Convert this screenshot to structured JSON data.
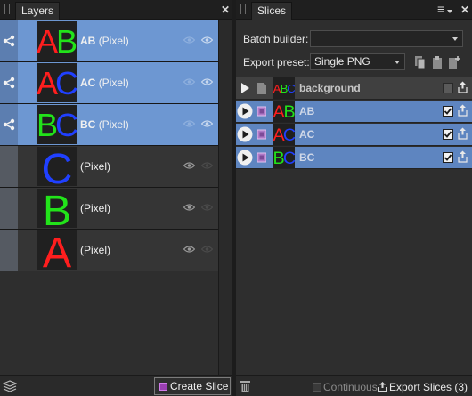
{
  "layers_panel": {
    "tab_label": "Layers",
    "close_glyph": "✕",
    "layers": [
      {
        "name": "AB",
        "type": "(Pixel)",
        "selected": true,
        "has_fx": true,
        "letters": [
          [
            "A",
            "#ff1e1e"
          ],
          [
            "B",
            "#22e31a"
          ]
        ]
      },
      {
        "name": "AC",
        "type": "(Pixel)",
        "selected": true,
        "has_fx": true,
        "letters": [
          [
            "A",
            "#ff1e1e"
          ],
          [
            "C",
            "#2040ff"
          ]
        ]
      },
      {
        "name": "BC",
        "type": "(Pixel)",
        "selected": true,
        "has_fx": true,
        "letters": [
          [
            "B",
            "#22e31a"
          ],
          [
            "C",
            "#2040ff"
          ]
        ]
      },
      {
        "name": "",
        "type": "(Pixel)",
        "selected": false,
        "has_fx": false,
        "letters": [
          [
            "C",
            "#2040ff"
          ]
        ]
      },
      {
        "name": "",
        "type": "(Pixel)",
        "selected": false,
        "has_fx": false,
        "letters": [
          [
            "B",
            "#22e31a"
          ]
        ]
      },
      {
        "name": "",
        "type": "(Pixel)",
        "selected": false,
        "has_fx": false,
        "letters": [
          [
            "A",
            "#ff1e1e"
          ]
        ]
      }
    ],
    "create_slice_label": "Create Slice",
    "icons": {
      "layer-stack": "layers-icon",
      "fx": "fx-link-icon",
      "visibility": "eye-icon"
    }
  },
  "slices_panel": {
    "tab_label": "Slices",
    "menu_glyph": "≡",
    "close_glyph": "✕",
    "batch_builder_label": "Batch builder:",
    "batch_builder_value": "",
    "export_preset_label": "Export preset:",
    "export_preset_value": "Single PNG",
    "slices": [
      {
        "name": "background",
        "selected": false,
        "checked": false,
        "letters": [
          [
            "A",
            "#ff1e1e"
          ],
          [
            "B",
            "#22e31a"
          ],
          [
            "C",
            "#2040ff"
          ]
        ]
      },
      {
        "name": "AB",
        "selected": true,
        "checked": true,
        "letters": [
          [
            "A",
            "#ff1e1e"
          ],
          [
            "B",
            "#22e31a"
          ]
        ]
      },
      {
        "name": "AC",
        "selected": true,
        "checked": true,
        "letters": [
          [
            "A",
            "#ff1e1e"
          ],
          [
            "C",
            "#2040ff"
          ]
        ]
      },
      {
        "name": "BC",
        "selected": true,
        "checked": true,
        "letters": [
          [
            "B",
            "#22e31a"
          ],
          [
            "C",
            "#2040ff"
          ]
        ]
      }
    ],
    "continuous_label": "Continuous",
    "export_slices_label": "Export Slices (3)"
  },
  "colors": {
    "selection": "#6d97d2",
    "slice_selection": "#5e85c0",
    "red": "#ff1e1e",
    "green": "#22e31a",
    "blue": "#2040ff"
  }
}
